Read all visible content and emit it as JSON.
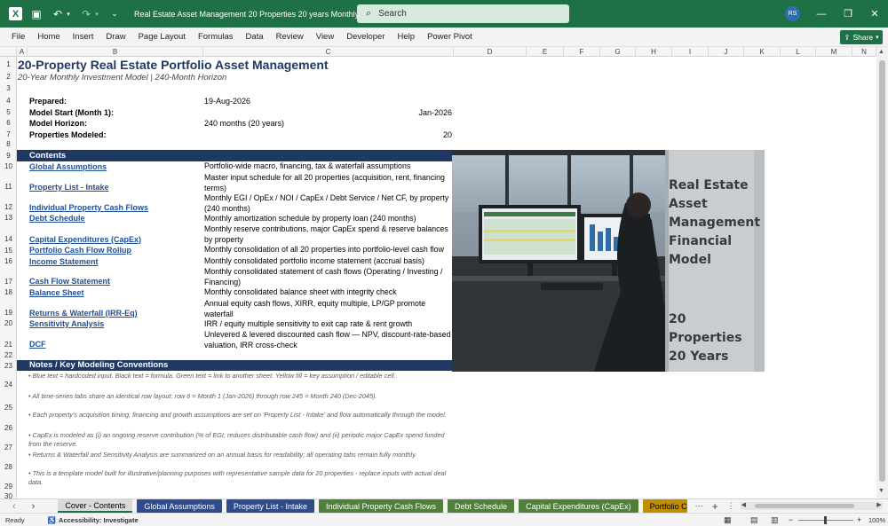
{
  "window": {
    "title": "Real Estate Asset Management 20 Properties  20 years Monthly DCF.xlsx  -  E...",
    "search_placeholder": "Search",
    "user_initials": "RS"
  },
  "menu": [
    "File",
    "Home",
    "Insert",
    "Draw",
    "Page Layout",
    "Formulas",
    "Data",
    "Review",
    "View",
    "Developer",
    "Help",
    "Power Pivot"
  ],
  "share_label": "Share",
  "columns": [
    "A",
    "B",
    "C",
    "D",
    "E",
    "F",
    "G",
    "H",
    "I",
    "J",
    "K",
    "L",
    "M",
    "N"
  ],
  "rows": [
    "1",
    "2",
    "3",
    "4",
    "5",
    "6",
    "7",
    "8",
    "9",
    "10",
    "11",
    "12",
    "13",
    "14",
    "15",
    "16",
    "17",
    "18",
    "19",
    "20",
    "21",
    "22",
    "23",
    "24",
    "25",
    "26",
    "27",
    "28",
    "29",
    "30"
  ],
  "sheet": {
    "title": "20-Property Real Estate Portfolio Asset Management",
    "subtitle": "20-Year Monthly Investment Model  |  240-Month Horizon",
    "info": [
      {
        "label": "Prepared:",
        "value": "19-Aug-2026",
        "align": "left"
      },
      {
        "label": "Model Start (Month 1):",
        "value": "Jan-2026",
        "align": "right"
      },
      {
        "label": "Model Horizon:",
        "value": "240 months (20 years)",
        "align": "left"
      },
      {
        "label": "Properties Modeled:",
        "value": "20",
        "align": "right"
      }
    ],
    "contents_header": "Contents",
    "contents": [
      {
        "link": "Global Assumptions",
        "desc": "Portfolio-wide macro, financing, tax & waterfall assumptions"
      },
      {
        "link": "Property List - Intake",
        "desc": "Master input schedule for all 20 properties (acquisition, rent, financing terms)"
      },
      {
        "link": "Individual Property Cash Flows",
        "desc": "Monthly EGI / OpEx / NOI / CapEx / Debt Service / Net CF, by property (240 months)"
      },
      {
        "link": "Debt Schedule",
        "desc": "Monthly amortization schedule by property loan (240 months)"
      },
      {
        "link": "Capital Expenditures (CapEx)",
        "desc": "Monthly reserve contributions, major CapEx spend & reserve balances by property"
      },
      {
        "link": "Portfolio Cash Flow Rollup",
        "desc": "Monthly consolidation of all 20 properties into portfolio-level cash flow"
      },
      {
        "link": "Income Statement",
        "desc": "Monthly consolidated portfolio income statement (accrual basis)"
      },
      {
        "link": "Cash Flow Statement",
        "desc": "Monthly consolidated statement of cash flows (Operating / Investing / Financing)"
      },
      {
        "link": "Balance Sheet",
        "desc": "Monthly consolidated balance sheet with integrity check"
      },
      {
        "link": "Returns & Waterfall (IRR-Eq)",
        "desc": "Annual equity cash flows, XIRR, equity multiple, LP/GP promote waterfall"
      },
      {
        "link": "Sensitivity Analysis",
        "desc": "IRR / equity multiple sensitivity to exit cap rate & rent growth"
      },
      {
        "link": "DCF",
        "desc": "Unlevered & levered discounted cash flow — NPV, discount-rate-based valuation, IRR cross-check"
      }
    ],
    "notes_header": "Notes / Key Modeling Conventions",
    "notes": [
      "• Blue text = hardcoded input. Black text = formula. Green text = link to another sheet. Yellow fill = key assumption / editable cell.",
      "• All time-series tabs share an identical row layout: row 6 = Month 1 (Jan-2026) through row 245 = Month 240 (Dec-2045).",
      "• Each property's acquisition timing, financing and growth assumptions are set on 'Property List - Intake' and flow automatically through the model.",
      "• CapEx is modeled as (i) an ongoing reserve contribution (% of EGI; reduces distributable cash flow) and (ii) periodic major CapEx spend funded from the reserve.",
      "• Returns & Waterfall and Sensitivity Analysis are summarized on an annual basis for readability; all operating tabs remain fully monthly.",
      "• This is a template model built for illustrative/planning purposes with representative sample data for 20 properties - replace inputs with actual deal data."
    ],
    "hero_text": [
      "Real Estate",
      "Asset",
      "Management",
      "Financial",
      "Model"
    ],
    "hero_sub": [
      "20 Properties",
      "20 Years"
    ]
  },
  "tabs": [
    {
      "label": "Cover - Contents",
      "color": "#d9d9d9",
      "fg": "#000000",
      "active": true
    },
    {
      "label": "Global Assumptions",
      "color": "#2f4b8a",
      "fg": "#ffffff"
    },
    {
      "label": "Property List - Intake",
      "color": "#2f4b8a",
      "fg": "#ffffff"
    },
    {
      "label": "Individual Property Cash Flows",
      "color": "#4f7f3a",
      "fg": "#ffffff"
    },
    {
      "label": "Debt Schedule",
      "color": "#4f7f3a",
      "fg": "#ffffff"
    },
    {
      "label": "Capital Expenditures (CapEx)",
      "color": "#4f7f3a",
      "fg": "#ffffff"
    },
    {
      "label": "Portfolio C",
      "color": "#bf8f00",
      "fg": "#000000"
    }
  ],
  "status": {
    "ready": "Ready",
    "accessibility": "Accessibility: Investigate",
    "zoom": "100%"
  }
}
